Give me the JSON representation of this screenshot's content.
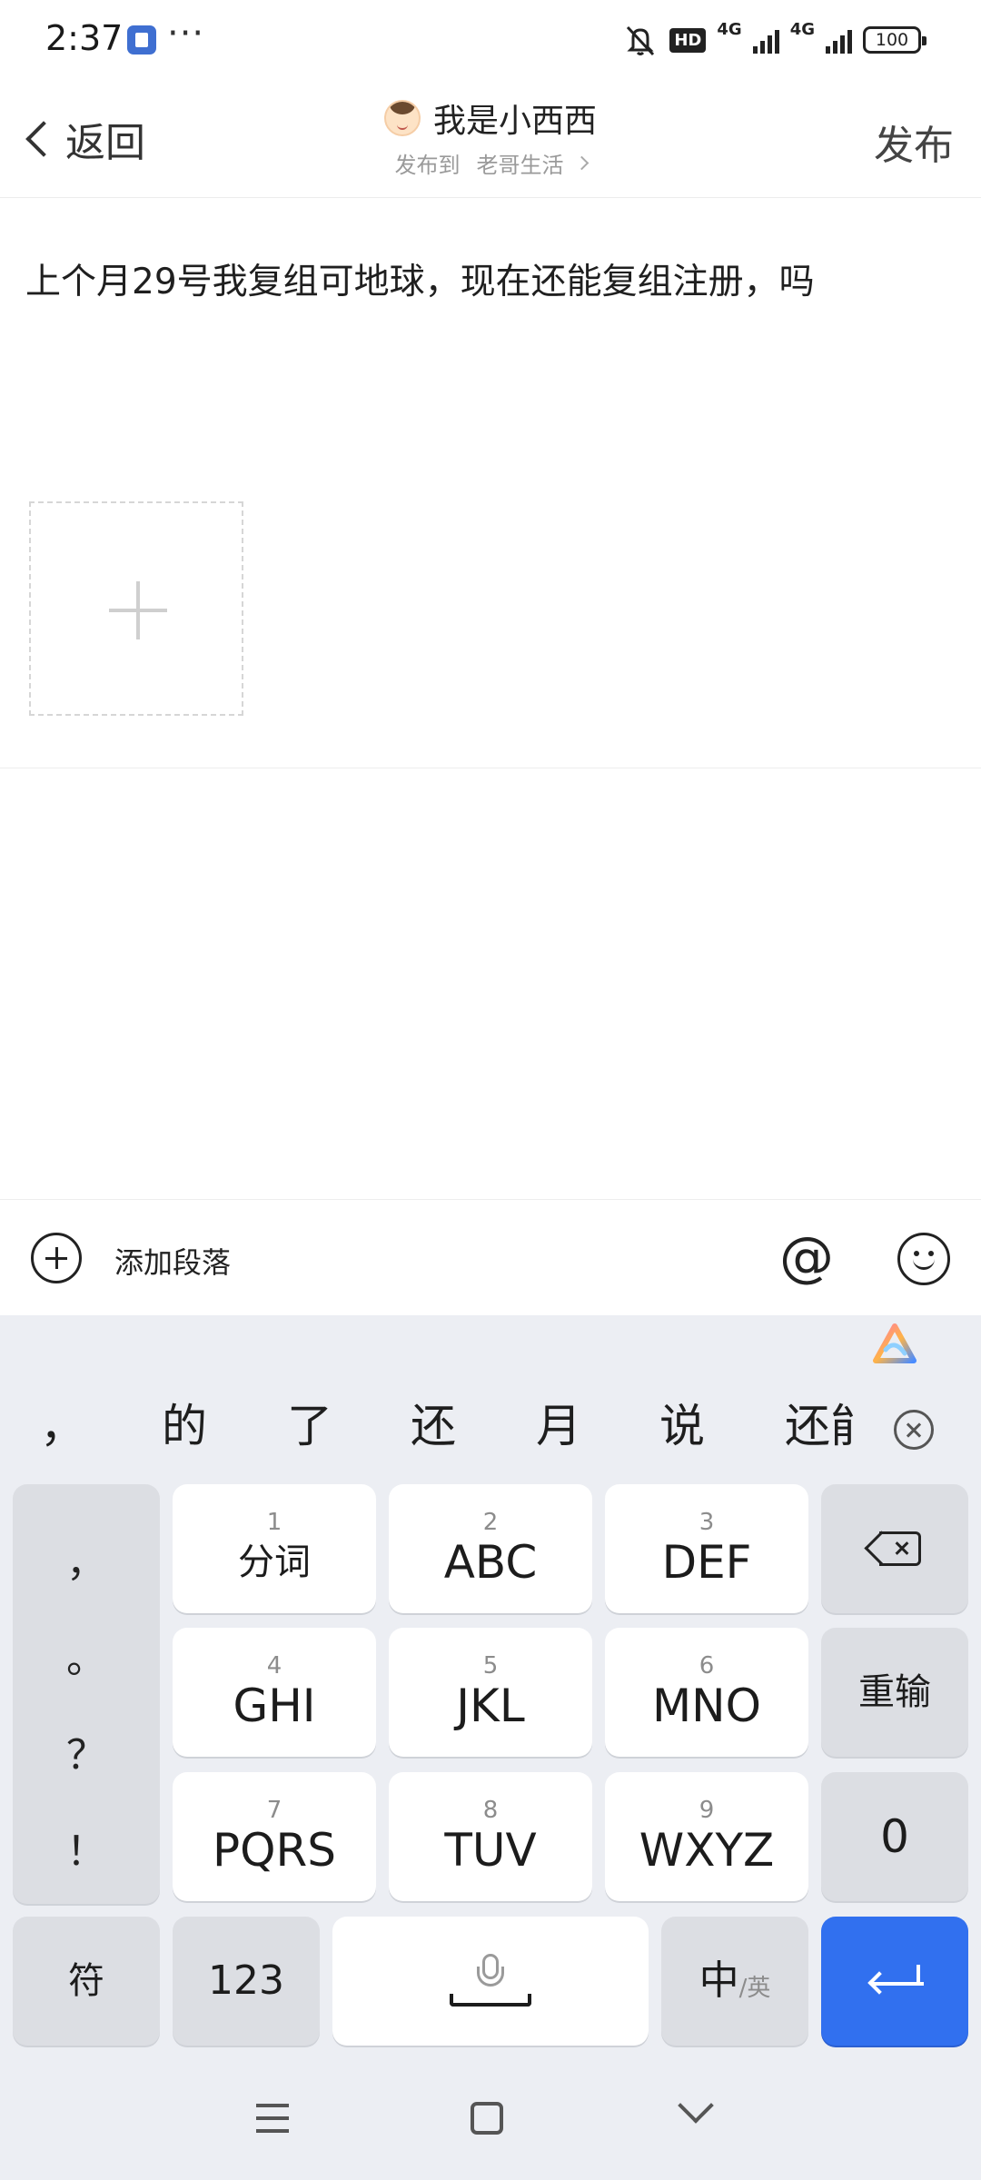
{
  "status_bar": {
    "time": "2:37",
    "more": "···",
    "hd_badge": "HD",
    "network_1": "4G",
    "network_2": "4G",
    "battery": "100"
  },
  "nav": {
    "back_label": "返回",
    "author_name": "我是小西西",
    "post_to_label": "发布到",
    "post_to_target": "老哥生活",
    "publish_label": "发布"
  },
  "editor": {
    "content": "上个月29号我复组可地球，现在还能复组注册，吗"
  },
  "toolbar": {
    "add_paragraph_label": "添加段落",
    "mention_symbol": "@"
  },
  "keyboard": {
    "candidates": [
      "，",
      "的",
      "了",
      "还",
      "月",
      "说",
      "还能"
    ],
    "punctuation": [
      "，",
      "。",
      "？",
      "！"
    ],
    "keys": [
      {
        "num": "1",
        "label": "分词"
      },
      {
        "num": "2",
        "label": "ABC"
      },
      {
        "num": "3",
        "label": "DEF"
      },
      {
        "num": "4",
        "label": "GHI"
      },
      {
        "num": "5",
        "label": "JKL"
      },
      {
        "num": "6",
        "label": "MNO"
      },
      {
        "num": "7",
        "label": "PQRS"
      },
      {
        "num": "8",
        "label": "TUV"
      },
      {
        "num": "9",
        "label": "WXYZ"
      }
    ],
    "reenter_label": "重输",
    "zero_label": "0",
    "symbols_label": "符",
    "numbers_label": "123",
    "lang_main": "中",
    "lang_alt": "/英"
  },
  "colors": {
    "accent_blue": "#3170ef",
    "keyboard_bg": "#eceef3"
  }
}
